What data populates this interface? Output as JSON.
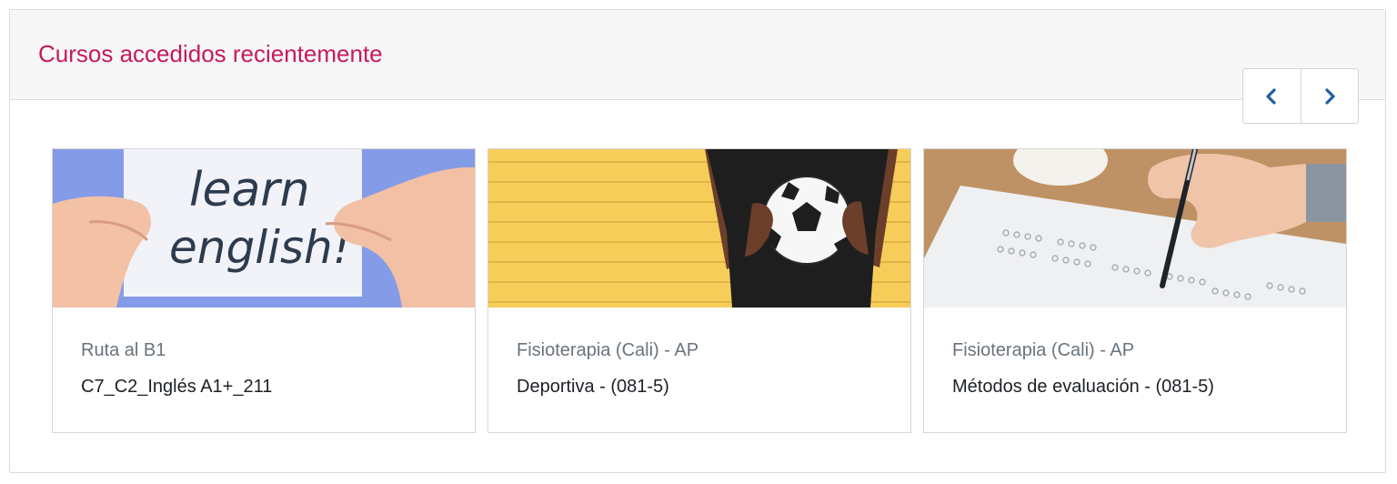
{
  "block": {
    "title": "Cursos accedidos recientemente",
    "prev_icon": "chevron-left-icon",
    "next_icon": "chevron-right-icon",
    "accent_color": "#c7195d",
    "nav_color": "#1f5f9e"
  },
  "courses": [
    {
      "category": "Ruta al B1",
      "name": "C7_C2_Inglés A1+_211",
      "image": "learn-english-card-image",
      "image_text_1": "learn",
      "image_text_2": "english!"
    },
    {
      "category": "Fisioterapia (Cali) - AP",
      "name": "Deportiva - (081-5)",
      "image": "soccer-ball-image"
    },
    {
      "category": "Fisioterapia (Cali) - AP",
      "name": "Métodos de evaluación - (081-5)",
      "image": "exam-answer-sheet-image"
    }
  ]
}
